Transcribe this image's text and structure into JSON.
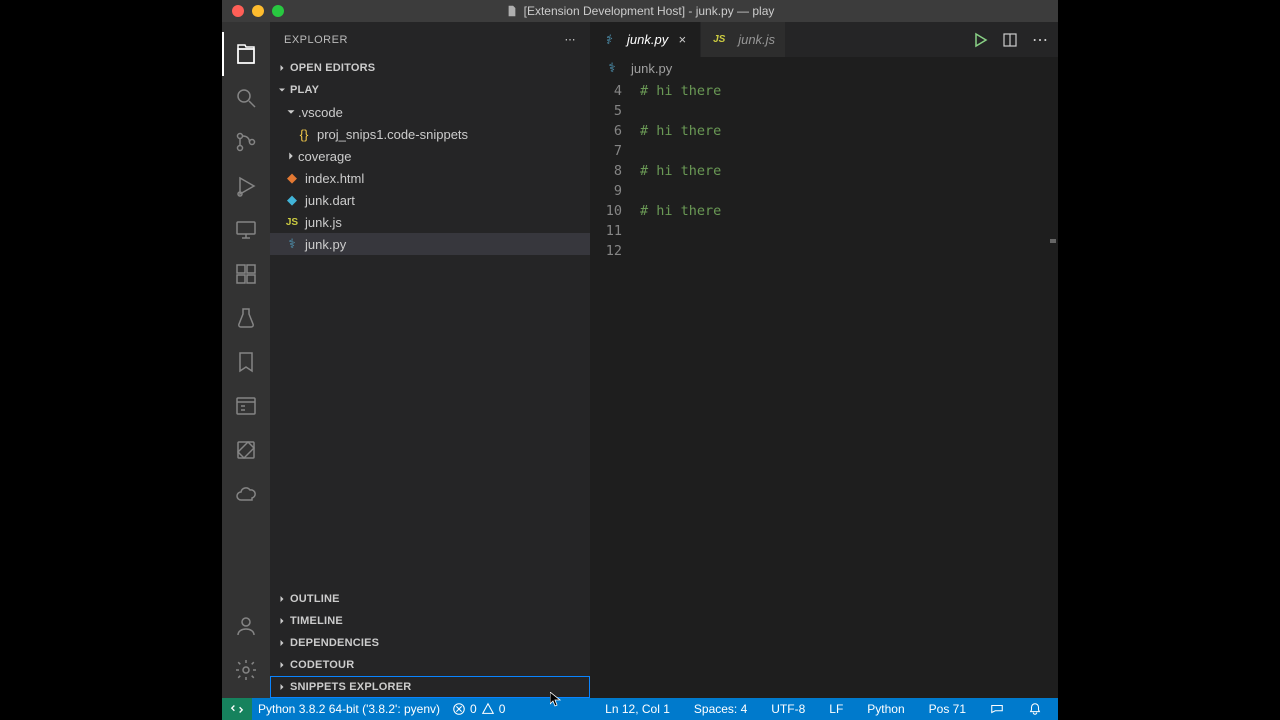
{
  "title": "[Extension Development Host] - junk.py — play",
  "sidebar": {
    "title": "EXPLORER",
    "openEditors": "OPEN EDITORS",
    "folderName": "PLAY",
    "panels": [
      "OUTLINE",
      "TIMELINE",
      "DEPENDENCIES",
      "CODETOUR",
      "SNIPPETS EXPLORER"
    ]
  },
  "tree": {
    "vscodeFolder": ".vscode",
    "snips": "proj_snips1.code-snippets",
    "coverage": "coverage",
    "index": "index.html",
    "dart": "junk.dart",
    "js": "junk.js",
    "py": "junk.py"
  },
  "tabs": [
    {
      "label": "junk.py",
      "active": true
    },
    {
      "label": "junk.js",
      "active": false
    }
  ],
  "breadcrumb": "junk.py",
  "lines": [
    {
      "num": "4",
      "text": "# hi there"
    },
    {
      "num": "5",
      "text": ""
    },
    {
      "num": "6",
      "text": "# hi there"
    },
    {
      "num": "7",
      "text": ""
    },
    {
      "num": "8",
      "text": "# hi there"
    },
    {
      "num": "9",
      "text": ""
    },
    {
      "num": "10",
      "text": "# hi there"
    },
    {
      "num": "11",
      "text": ""
    },
    {
      "num": "12",
      "text": ""
    }
  ],
  "status": {
    "interpreter": "Python 3.8.2 64-bit ('3.8.2': pyenv)",
    "errors": "0",
    "warnings": "0",
    "lncol": "Ln 12, Col 1",
    "spaces": "Spaces: 4",
    "encoding": "UTF-8",
    "eol": "LF",
    "language": "Python",
    "pos": "Pos 71"
  }
}
